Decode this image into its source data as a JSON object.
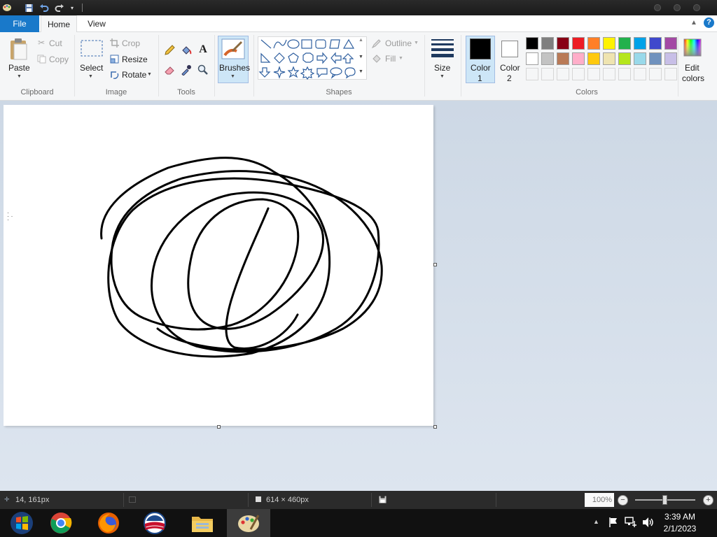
{
  "titlebar": {
    "qa_icons": [
      "paint-app-icon",
      "save-icon",
      "undo-icon",
      "redo-icon",
      "customize-icon"
    ]
  },
  "tabs": {
    "file": "File",
    "home": "Home",
    "view": "View"
  },
  "clipboard": {
    "paste": "Paste",
    "cut": "Cut",
    "copy": "Copy",
    "label": "Clipboard"
  },
  "image": {
    "select": "Select",
    "crop": "Crop",
    "resize": "Resize",
    "rotate": "Rotate",
    "label": "Image"
  },
  "tools": {
    "label": "Tools"
  },
  "brushes": {
    "label": "Brushes"
  },
  "shapes": {
    "outline": "Outline",
    "fill": "Fill",
    "label": "Shapes"
  },
  "size": {
    "label": "Size"
  },
  "color1": {
    "line1": "Color",
    "line2": "1",
    "value": "#000000"
  },
  "color2": {
    "line1": "Color",
    "line2": "2",
    "value": "#ffffff"
  },
  "colors": {
    "label": "Colors",
    "edit_line1": "Edit",
    "edit_line2": "colors",
    "row1": [
      "#000000",
      "#7f7f7f",
      "#880015",
      "#ed1c24",
      "#ff7f27",
      "#fff200",
      "#22b14c",
      "#00a2e8",
      "#3f48cc",
      "#a349a4"
    ],
    "row2": [
      "#ffffff",
      "#c3c3c3",
      "#b97a57",
      "#ffaec9",
      "#ffc90e",
      "#efe4b0",
      "#b5e61d",
      "#99d9ea",
      "#7092be",
      "#c8bfe7"
    ]
  },
  "status": {
    "cursor_pos": "14, 161px",
    "canvas_size": "614 × 460px",
    "zoom": "100%",
    "zoom_fraction": 0.5
  },
  "taskbar": {
    "time": "3:39 AM",
    "date": "2/1/2023"
  }
}
